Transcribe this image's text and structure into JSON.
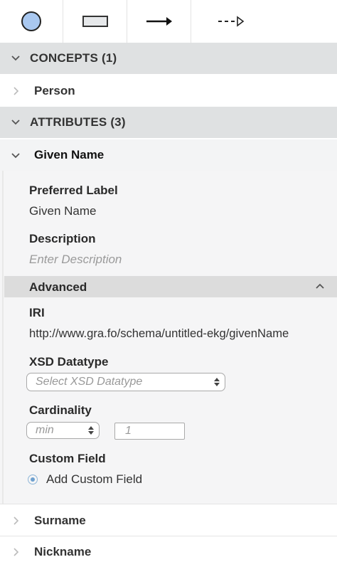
{
  "toolbar": {
    "tools": [
      {
        "icon": "circle-node-icon"
      },
      {
        "icon": "rectangle-node-icon"
      },
      {
        "icon": "solid-arrow-icon"
      },
      {
        "icon": "dashed-arrow-icon"
      }
    ]
  },
  "concepts": {
    "header": "CONCEPTS (1)",
    "items": [
      "Person"
    ]
  },
  "attributes": {
    "header": "ATTRIBUTES (3)",
    "expanded_item": "Given Name",
    "items_after": [
      "Surname",
      "Nickname"
    ]
  },
  "detail": {
    "preferred_label_title": "Preferred Label",
    "preferred_label_value": "Given Name",
    "description_title": "Description",
    "description_placeholder": "Enter Description",
    "advanced_title": "Advanced",
    "iri_title": "IRI",
    "iri_value": "http://www.gra.fo/schema/untitled-ekg/givenName",
    "xsd_title": "XSD Datatype",
    "xsd_placeholder": "Select XSD Datatype",
    "cardinality_title": "Cardinality",
    "cardinality_min": "min",
    "cardinality_value": "1",
    "custom_field_title": "Custom Field",
    "add_custom_field": "Add Custom Field"
  },
  "colors": {
    "circle_fill": "#a9c8f0",
    "section_header_bg": "#dfe1e2",
    "advanced_bg": "#dcdcdc",
    "radio_accent": "#6ea0cf"
  }
}
